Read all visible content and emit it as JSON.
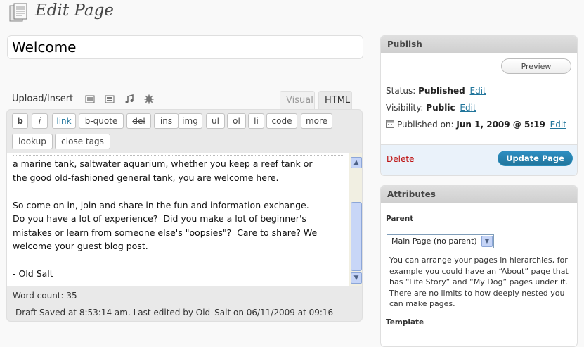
{
  "header": {
    "title": "Edit Page",
    "icon": "page-icon"
  },
  "post": {
    "title": "Welcome"
  },
  "media_buttons": {
    "label": "Upload/Insert",
    "icons": [
      "image-icon",
      "video-icon",
      "audio-icon",
      "media-icon"
    ]
  },
  "editor_tabs": {
    "visual": "Visual",
    "html": "HTML"
  },
  "quicktags": [
    "b",
    "i",
    "link",
    "b-quote",
    "del",
    "ins",
    "img",
    "ul",
    "ol",
    "li",
    "code",
    "more",
    "lookup",
    "close tags"
  ],
  "content_lines": [
    "a marine tank, saltwater aquarium, whether you keep a reef tank or",
    "the good old-fashioned general tank, you are welcome here.",
    "",
    "So come on in, join and share in the fun and information exchange.",
    "Do you have a lot of experience?  Did you make a lot of beginner's",
    "mistakes or learn from someone else's \"oopsies\"?  Care to share? We",
    "welcome your guest blog post.",
    "",
    "- Old Salt"
  ],
  "footer": {
    "word_count": "Word count: 35",
    "draft_status": "Draft Saved at 8:53:14 am. Last edited by Old_Salt on 06/11/2009 at 09:16"
  },
  "publish": {
    "title": "Publish",
    "preview_label": "Preview",
    "status_label": "Status:",
    "status_value": "Published",
    "visibility_label": "Visibility:",
    "visibility_value": "Public",
    "published_label": "Published on:",
    "published_value": "Jun 1, 2009 @ 5:19",
    "edit_label": "Edit",
    "delete_label": "Delete",
    "update_label": "Update Page"
  },
  "attributes": {
    "title": "Attributes",
    "parent_label": "Parent",
    "parent_selected": "Main Page (no parent)",
    "help_text": "You can arrange your pages in hierarchies, for example you could have an “About” page that has “Life Story” and “My Dog” pages under it. There are no limits to how deeply nested you can make pages.",
    "template_label": "Template"
  },
  "colors": {
    "link": "#21759b",
    "delete": "#bc0b0b",
    "update_button": "#21759b"
  }
}
